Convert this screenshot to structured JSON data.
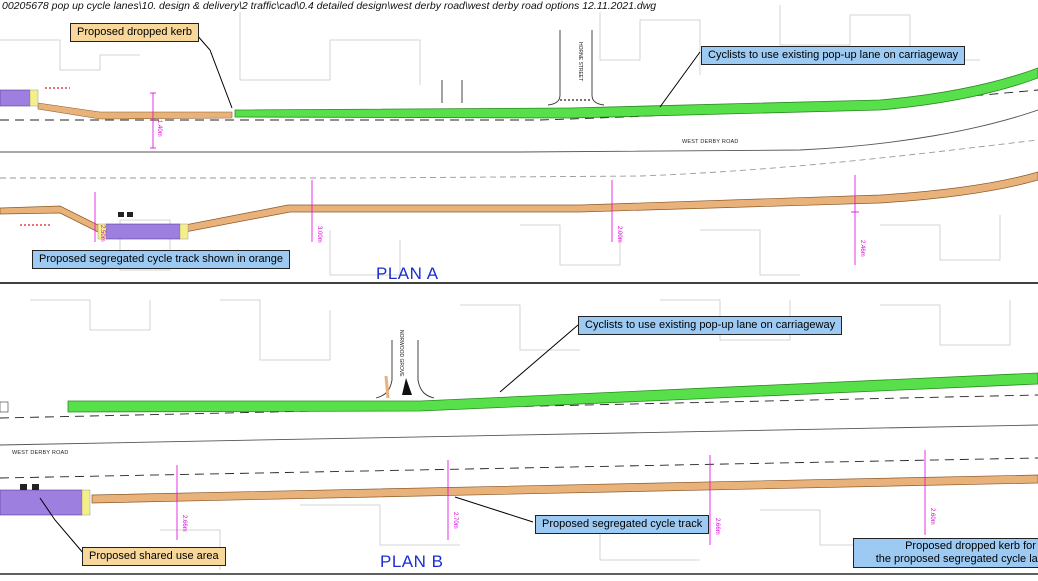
{
  "file_path": "00205678 pop up cycle lanes\\10. design & delivery\\2 traffic\\cad\\0.4 detailed design\\west derby road\\west derby road options 12.11.2021.dwg",
  "plan_a": {
    "label": "PLAN A",
    "road_name": "WEST DERBY ROAD",
    "side_street": "HORNE STREET",
    "callouts": {
      "dropped_kerb": "Proposed dropped kerb",
      "existing_lane": "Cyclists to use existing pop-up lane on carriageway",
      "segregated_orange": "Proposed segregated cycle track shown in orange"
    }
  },
  "plan_b": {
    "label": "PLAN B",
    "road_name": "WEST DERBY ROAD",
    "side_street": "NORWOOD GROVE",
    "callouts": {
      "existing_lane": "Cyclists to use existing pop-up lane on  carriageway",
      "segregated": "Proposed segregated cycle track",
      "shared_use": "Proposed shared use area",
      "dropped_kerb_line1": "Proposed dropped kerb for cy",
      "dropped_kerb_line2": "the proposed segregated cycle lane"
    }
  },
  "colors": {
    "green_lane": "#57e04a",
    "orange_track": "#e8b27a",
    "purple_area": "#9d7fe0",
    "yellow_kerb": "#f5ef8a",
    "dimension": "#e000e0",
    "plan_text": "#1a2fd0",
    "orange_callout": "#f8d79a",
    "blue_callout": "#9ccaf2"
  }
}
